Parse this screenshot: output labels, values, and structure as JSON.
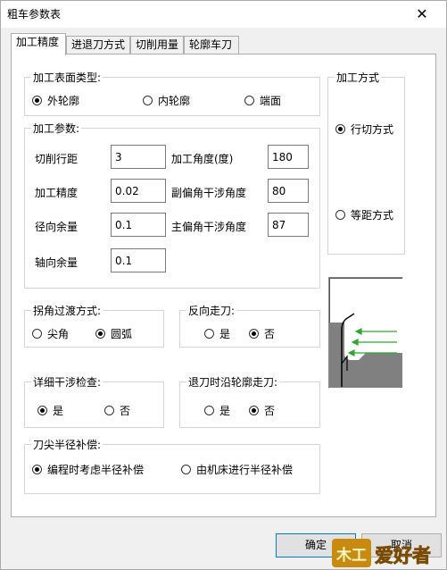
{
  "window": {
    "title": "粗车参数表",
    "close_glyph": "✕"
  },
  "tabs": [
    "加工精度",
    "进退刀方式",
    "切削用量",
    "轮廓车刀"
  ],
  "surface_type": {
    "legend": "加工表面类型:",
    "options": [
      "外轮廓",
      "内轮廓",
      "端面"
    ],
    "selected": 0
  },
  "machining_mode": {
    "legend": "加工方式",
    "options": [
      "行切方式",
      "等距方式"
    ],
    "selected": 0
  },
  "params": {
    "legend": "加工参数:",
    "cut_spacing": {
      "label": "切削行距",
      "value": "3"
    },
    "precision": {
      "label": "加工精度",
      "value": "0.02"
    },
    "radial_allowance": {
      "label": "径向余量",
      "value": "0.1"
    },
    "axial_allowance": {
      "label": "轴向余量",
      "value": "0.1"
    },
    "angle": {
      "label": "加工角度(度)",
      "value": "180"
    },
    "minor_angle": {
      "label": "副偏角干涉角度",
      "value": "80"
    },
    "major_angle": {
      "label": "主偏角干涉角度",
      "value": "87"
    }
  },
  "corner_transition": {
    "legend": "拐角过渡方式:",
    "options": [
      "尖角",
      "圆弧"
    ],
    "selected": 1
  },
  "reverse_feed": {
    "legend": "反向走刀:",
    "options": [
      "是",
      "否"
    ],
    "selected": 1
  },
  "interference_check": {
    "legend": "详细干涉检查:",
    "options": [
      "是",
      "否"
    ],
    "selected": 0
  },
  "retract_along_contour": {
    "legend": "退刀时沿轮廓走刀:",
    "options": [
      "是",
      "否"
    ],
    "selected": 1
  },
  "nose_radius_comp": {
    "legend": "刀尖半径补偿:",
    "options": [
      "编程时考虑半径补偿",
      "由机床进行半径补偿"
    ],
    "selected": 0
  },
  "buttons": {
    "ok": "确定",
    "cancel": "取消"
  },
  "watermark": {
    "text": "爱好者",
    "badge": "木工"
  },
  "colors": {
    "arrow": "#2ea82e",
    "part_fill": "#808080",
    "watermark": "#e8b800",
    "default_border": "#0078d7"
  }
}
